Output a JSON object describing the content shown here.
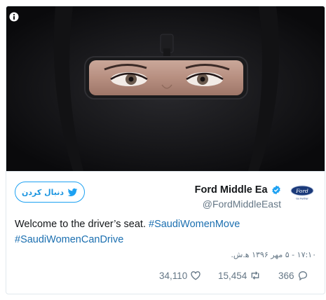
{
  "media": {
    "description_icon": "info-icon",
    "colors": {
      "background": "#0b0b0d",
      "mirror_frame": "#1a1a1c"
    }
  },
  "header": {
    "follow_label": "دنبال کردن",
    "follow_icon": "twitter-bird-icon",
    "display_name": "Ford Middle Ea",
    "verified_icon": "verified-badge-icon",
    "handle": "@FordMiddleEast",
    "avatar_icon": "ford-logo-icon"
  },
  "tweet": {
    "text_plain": "Welcome to the driver’s seat. ",
    "hashtag_1": "#SaudiWomenMove",
    "hashtag_2": "#SaudiWomenCanDrive",
    "timestamp": "۱۷:۱۰ - ۵ مهر ۱۳۹۶ ه‍.ش."
  },
  "actions": {
    "likes": "34,110",
    "retweets": "15,454",
    "replies": "366"
  },
  "colors": {
    "accent": "#1da1f2",
    "link": "#1b6fb0",
    "muted": "#657786",
    "ford_blue": "#1b3a7a"
  }
}
